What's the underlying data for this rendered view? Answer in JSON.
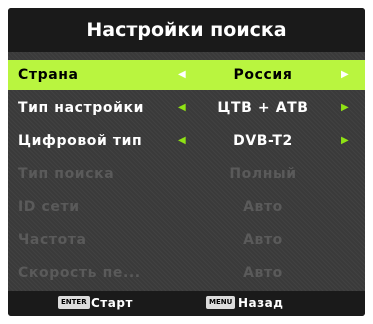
{
  "header": {
    "title": "Настройки поиска"
  },
  "menu": {
    "items": [
      {
        "label": "Страна",
        "value": "Россия",
        "left_arrow": "◀",
        "right_arrow": "▶",
        "state": "selected"
      },
      {
        "label": "Тип настройки",
        "value": "ЦТВ + АТВ",
        "left_arrow": "◀",
        "right_arrow": "▶",
        "state": "active"
      },
      {
        "label": "Цифровой тип",
        "value": "DVB-T2",
        "left_arrow": "◀",
        "right_arrow": "▶",
        "state": "active"
      },
      {
        "label": "Тип поиска",
        "value": "Полный",
        "state": "disabled"
      },
      {
        "label": "ID сети",
        "value": "Авто",
        "state": "disabled"
      },
      {
        "label": "Частота",
        "value": "Авто",
        "state": "disabled"
      },
      {
        "label": "Скорость пе...",
        "value": "Авто",
        "state": "disabled"
      }
    ]
  },
  "footer": {
    "enter_key": "ENTER",
    "enter_label": "Старт",
    "menu_key": "MENU",
    "menu_label": "Назад"
  },
  "colors": {
    "highlight": "#b9f53f",
    "arrow_active": "#8fe214",
    "panel": "#3a3a3a",
    "bar": "#1a1a1a",
    "disabled_text": "#5a5a5a"
  }
}
